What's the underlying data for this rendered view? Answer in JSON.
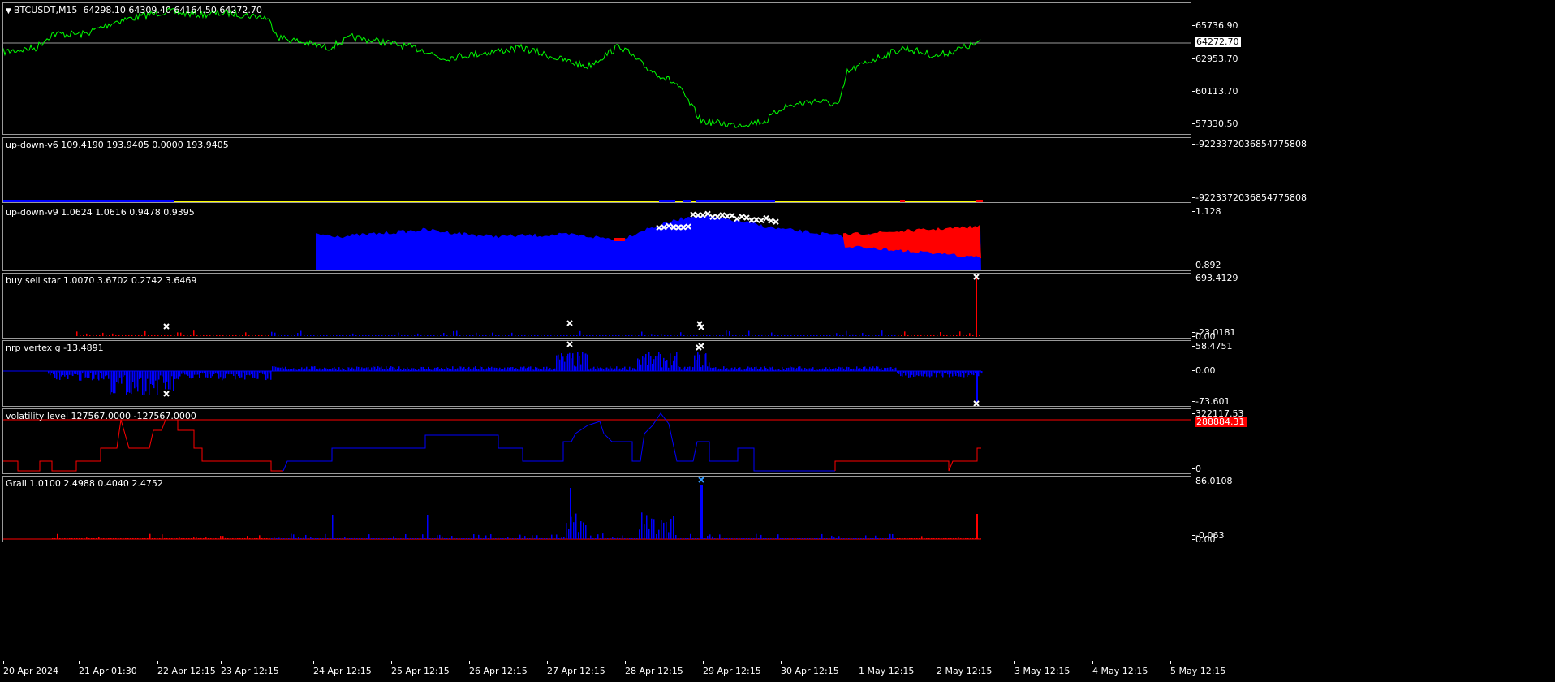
{
  "main": {
    "symbol_label": "BTCUSDT,M15",
    "ohlc": "64298.10 64309.40 64164.50 64272.70",
    "price_levels": [
      "65736.90",
      "62953.70",
      "60113.70",
      "57330.50"
    ],
    "current_price": "64272.70",
    "line_color": "#00ff00"
  },
  "indicators": [
    {
      "label": "up-down-v6 109.4190 193.9405 0.0000 193.9405",
      "levels": [
        "-9223372036854775808",
        "-9223372036854775808"
      ]
    },
    {
      "label": "up-down-v9 1.0624 1.0616 0.9478 0.9395",
      "levels": [
        "1.128",
        "0.892"
      ]
    },
    {
      "label": "buy sell star 1.0070 3.6702 0.2742 3.6469",
      "levels": [
        "693.4129",
        "-23.0181",
        "0.00"
      ]
    },
    {
      "label": "nrp vertex g -13.4891",
      "levels": [
        "58.4751",
        "0.00",
        "-73.601"
      ]
    },
    {
      "label": "volatility level 127567.0000 -127567.0000",
      "levels": [
        "322117.53",
        "0"
      ],
      "tag": "288884.31"
    },
    {
      "label": "Grail 1.0100 2.4988 0.4040 2.4752",
      "levels": [
        "86.0108",
        "-0.063",
        "0.00"
      ]
    }
  ],
  "time_labels": [
    "20 Apr 2024",
    "21 Apr 01:30",
    "22 Apr 12:15",
    "23 Apr 12:15",
    "24 Apr 12:15",
    "25 Apr 12:15",
    "26 Apr 12:15",
    "27 Apr 12:15",
    "28 Apr 12:15",
    "29 Apr 12:15",
    "30 Apr 12:15",
    "1 May 12:15",
    "2 May 12:15",
    "3 May 12:15",
    "4 May 12:15",
    "5 May 12:15"
  ],
  "colors": {
    "blue": "#0000ff",
    "red": "#ff0000",
    "yellow": "#ffff00",
    "white": "#ffffff",
    "grid_border": "#9a9a9a"
  },
  "icons": {
    "collapse": "triangle-down-icon",
    "marker": "cross-marker-icon"
  }
}
